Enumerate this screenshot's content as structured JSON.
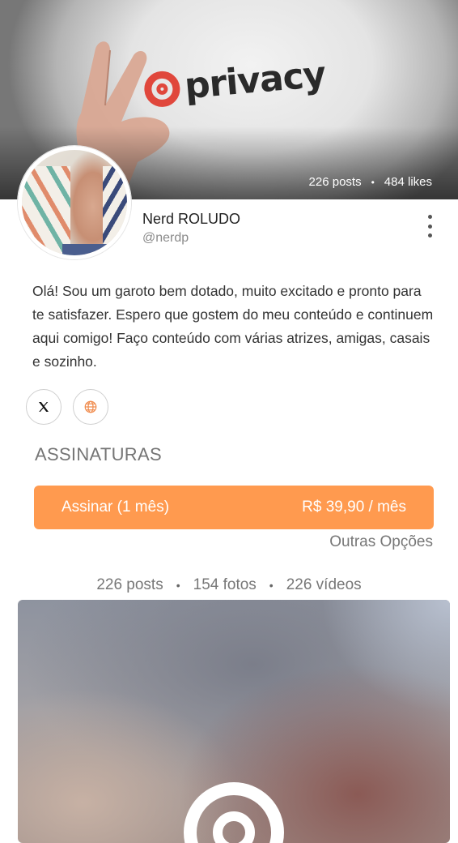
{
  "cover": {
    "brand_text": "privacy",
    "posts": "226 posts",
    "likes": "484 likes",
    "separator": "•"
  },
  "profile": {
    "name": "Nerd ROLUDO",
    "handle": "@nerdp",
    "bio": "Olá! Sou um garoto bem dotado, muito excitado e pronto para te satisfazer. Espero que gostem do meu conteúdo e continuem aqui comigo! Faço conteúdo com várias atrizes, amigas, casais e sozinho."
  },
  "social": {
    "x_icon": "x-logo-icon",
    "web_icon": "globe-icon"
  },
  "subscriptions": {
    "title": "ASSINATURAS",
    "plan_label": "Assinar (1 mês)",
    "plan_price": "R$ 39,90 / mês",
    "other_options": "Outras Opções"
  },
  "counts": {
    "posts": "226 posts",
    "photos": "154 fotos",
    "videos": "226 vídeos",
    "separator": "•"
  },
  "colors": {
    "accent": "#ff9a4f",
    "brand_red": "#e0473c"
  }
}
